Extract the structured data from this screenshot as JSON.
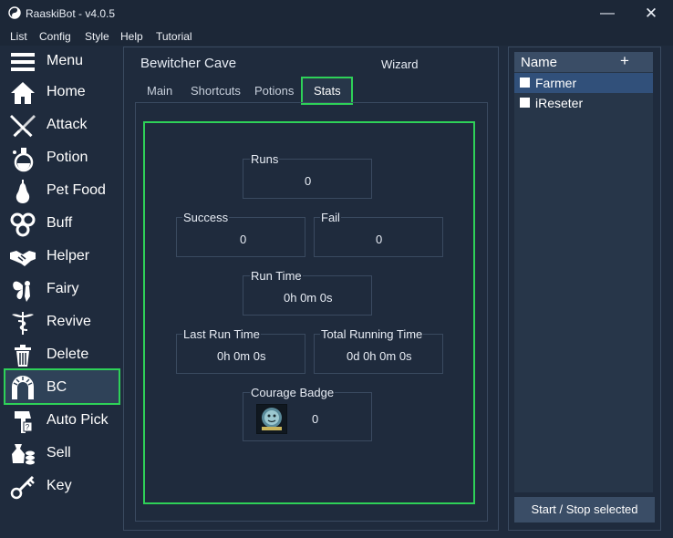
{
  "window": {
    "title": "RaaskiBot - v4.0.5",
    "minimize_glyph": "—",
    "close_glyph": "✕"
  },
  "menubar": [
    "List",
    "Config",
    "Style",
    "Help",
    "Tutorial"
  ],
  "sidebar": {
    "active_index": 10,
    "items": [
      {
        "label": "Menu",
        "icon": "hamburger-menu-icon"
      },
      {
        "label": "Home",
        "icon": "house-icon"
      },
      {
        "label": "Attack",
        "icon": "swords-icon"
      },
      {
        "label": "Potion",
        "icon": "potion-flask-icon"
      },
      {
        "label": "Pet Food",
        "icon": "pear-icon"
      },
      {
        "label": "Buff",
        "icon": "swirl-triskelion-icon"
      },
      {
        "label": "Helper",
        "icon": "handshake-icon"
      },
      {
        "label": "Fairy",
        "icon": "fairy-icon"
      },
      {
        "label": "Revive",
        "icon": "caduceus-icon"
      },
      {
        "label": "Delete",
        "icon": "trash-can-icon"
      },
      {
        "label": "BC",
        "icon": "cave-arch-icon"
      },
      {
        "label": "Auto Pick",
        "icon": "grabbing-hand-icon"
      },
      {
        "label": "Sell",
        "icon": "coin-bag-icon"
      },
      {
        "label": "Key",
        "icon": "key-icon"
      }
    ]
  },
  "main": {
    "title": "Bewitcher Cave",
    "wizard_label": "Wizard",
    "tabs": [
      "Main",
      "Shortcuts",
      "Potions",
      "Stats"
    ],
    "active_tab": "Stats",
    "stats": {
      "runs": {
        "label": "Runs",
        "value": "0"
      },
      "success": {
        "label": "Success",
        "value": "0"
      },
      "fail": {
        "label": "Fail",
        "value": "0"
      },
      "run_time": {
        "label": "Run Time",
        "value": "0h 0m 0s"
      },
      "last_run_time": {
        "label": "Last Run Time",
        "value": "0h 0m 0s"
      },
      "total_running_time": {
        "label": "Total Running Time",
        "value": "0d 0h 0m 0s"
      },
      "courage_badge": {
        "label": "Courage Badge",
        "value": "0",
        "icon": "courage-badge-icon"
      }
    }
  },
  "right_panel": {
    "header_name": "Name",
    "add_glyph": "+",
    "rows": [
      {
        "name": "Farmer",
        "checked": false,
        "selected": true
      },
      {
        "name": "iReseter",
        "checked": false,
        "selected": false
      }
    ],
    "start_stop_label": "Start / Stop selected"
  },
  "colors": {
    "accent_green": "#2ed158",
    "background": "#1f2b3d",
    "selection_blue": "#31507a",
    "header_bg": "#3a4d66"
  }
}
